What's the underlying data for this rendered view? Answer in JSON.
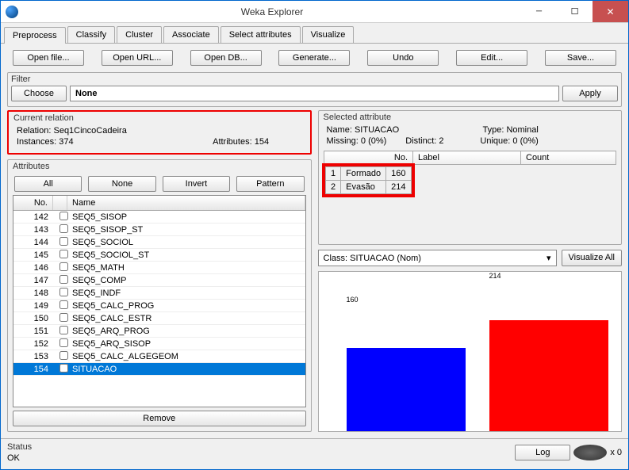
{
  "window": {
    "title": "Weka Explorer"
  },
  "tabs": [
    "Preprocess",
    "Classify",
    "Cluster",
    "Associate",
    "Select attributes",
    "Visualize"
  ],
  "toolbar": [
    "Open file...",
    "Open URL...",
    "Open DB...",
    "Generate...",
    "Undo",
    "Edit...",
    "Save..."
  ],
  "filter": {
    "label": "Filter",
    "choose": "Choose",
    "value": "None",
    "apply": "Apply"
  },
  "relation": {
    "legend": "Current relation",
    "relation_lbl": "Relation:",
    "relation_val": "Seq1CincoCadeira",
    "instances_lbl": "Instances:",
    "instances_val": "374",
    "attributes_lbl": "Attributes:",
    "attributes_val": "154"
  },
  "attrs": {
    "legend": "Attributes",
    "btns": [
      "All",
      "None",
      "Invert",
      "Pattern"
    ],
    "cols": {
      "no": "No.",
      "name": "Name"
    },
    "rows": [
      {
        "no": "142",
        "name": "SEQ5_SISOP"
      },
      {
        "no": "143",
        "name": "SEQ5_SISOP_ST"
      },
      {
        "no": "144",
        "name": "SEQ5_SOCIOL"
      },
      {
        "no": "145",
        "name": "SEQ5_SOCIOL_ST"
      },
      {
        "no": "146",
        "name": "SEQ5_MATH"
      },
      {
        "no": "147",
        "name": "SEQ5_COMP"
      },
      {
        "no": "148",
        "name": "SEQ5_INDF"
      },
      {
        "no": "149",
        "name": "SEQ5_CALC_PROG"
      },
      {
        "no": "150",
        "name": "SEQ5_CALC_ESTR"
      },
      {
        "no": "151",
        "name": "SEQ5_ARQ_PROG"
      },
      {
        "no": "152",
        "name": "SEQ5_ARQ_SISOP"
      },
      {
        "no": "153",
        "name": "SEQ5_CALC_ALGEGEOM"
      },
      {
        "no": "154",
        "name": "SITUACAO",
        "selected": true
      }
    ],
    "remove": "Remove"
  },
  "selected": {
    "legend": "Selected attribute",
    "name_lbl": "Name:",
    "name_val": "SITUACAO",
    "type_lbl": "Type:",
    "type_val": "Nominal",
    "missing_lbl": "Missing:",
    "missing_val": "0 (0%)",
    "distinct_lbl": "Distinct:",
    "distinct_val": "2",
    "unique_lbl": "Unique:",
    "unique_val": "0 (0%)",
    "cols": {
      "no": "No.",
      "label": "Label",
      "count": "Count"
    },
    "rows": [
      {
        "no": "1",
        "label": "Formado",
        "count": "160"
      },
      {
        "no": "2",
        "label": "Evasão",
        "count": "214"
      }
    ]
  },
  "class": {
    "value": "Class: SITUACAO (Nom)",
    "viz_all": "Visualize All"
  },
  "chart_data": {
    "type": "bar",
    "categories": [
      "Formado",
      "Evasão"
    ],
    "values": [
      160,
      214
    ],
    "colors": [
      "#0000ff",
      "#ff0000"
    ],
    "ylim": [
      0,
      214
    ]
  },
  "status": {
    "legend": "Status",
    "text": "OK",
    "log": "Log",
    "x0": "x 0"
  }
}
